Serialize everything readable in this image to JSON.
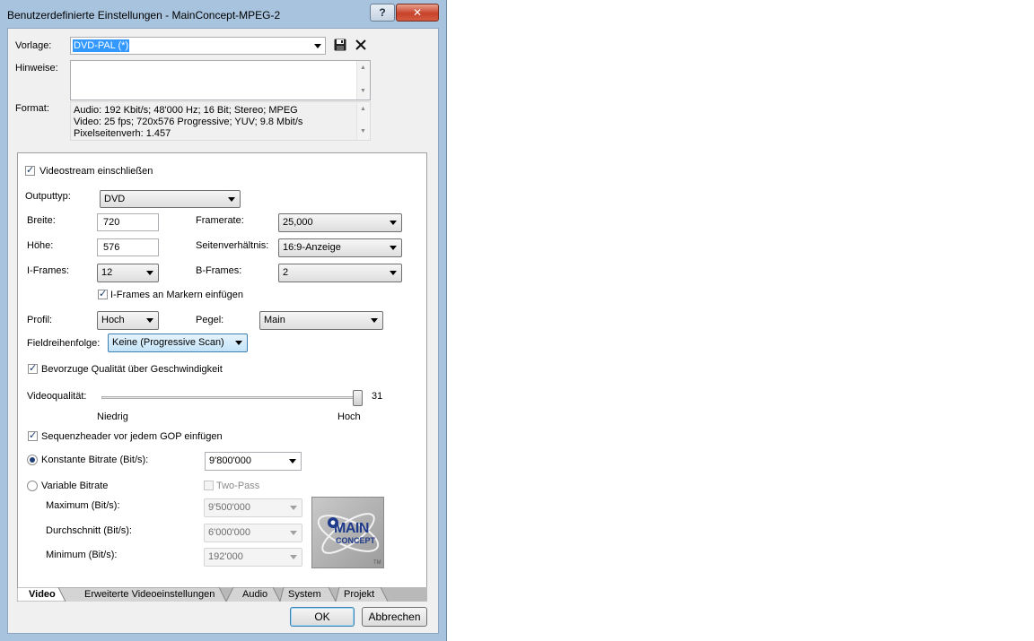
{
  "window": {
    "title": "Benutzerdefinierte Einstellungen - MainConcept-MPEG-2",
    "help_label": "?",
    "close_label": "✕"
  },
  "vorlage": {
    "label": "Vorlage:",
    "value": "DVD-PAL (*)"
  },
  "hinweise": {
    "label": "Hinweise:",
    "value": ""
  },
  "format": {
    "label": "Format:",
    "lines": [
      "Audio: 192 Kbit/s; 48'000 Hz; 16 Bit; Stereo; MPEG",
      "Video: 25 fps; 720x576 Progressive; YUV; 9.8 Mbit/s",
      "Pixelseitenverh: 1.457"
    ]
  },
  "video": {
    "include_stream": {
      "label": "Videostream einschließen",
      "checked": true
    },
    "output_type": {
      "label": "Outputtyp:",
      "value": "DVD"
    },
    "width": {
      "label": "Breite:",
      "value": "720"
    },
    "height": {
      "label": "Höhe:",
      "value": "576"
    },
    "framerate": {
      "label": "Framerate:",
      "value": "25,000"
    },
    "aspect": {
      "label": "Seitenverhältnis:",
      "value": "16:9-Anzeige"
    },
    "iframes": {
      "label": "I-Frames:",
      "value": "12"
    },
    "bframes": {
      "label": "B-Frames:",
      "value": "2"
    },
    "iframes_markers": {
      "label": "I-Frames an Markern einfügen",
      "checked": true
    },
    "profile": {
      "label": "Profil:",
      "value": "Hoch"
    },
    "level": {
      "label": "Pegel:",
      "value": "Main"
    },
    "field_order": {
      "label": "Fieldreihenfolge:",
      "value": "Keine (Progressive Scan)"
    },
    "prefer_quality": {
      "label": "Bevorzuge Qualität über Geschwindigkeit",
      "checked": true
    },
    "quality": {
      "label": "Videoqualität:",
      "value": "31",
      "min_label": "Niedrig",
      "max_label": "Hoch",
      "level": 1.0
    },
    "seq_header": {
      "label": "Sequenzheader vor jedem GOP einfügen",
      "checked": true
    },
    "constant_bitrate": {
      "label": "Konstante Bitrate (Bit/s):",
      "selected": true,
      "value": "9'800'000"
    },
    "variable_bitrate": {
      "label": "Variable Bitrate",
      "selected": false
    },
    "two_pass": {
      "label": "Two-Pass",
      "checked": false
    },
    "maximum": {
      "label": "Maximum (Bit/s):",
      "value": "9'500'000"
    },
    "average": {
      "label": "Durchschnitt (Bit/s):",
      "value": "6'000'000"
    },
    "minimum": {
      "label": "Minimum (Bit/s):",
      "value": "192'000"
    },
    "logo": {
      "line1": "MAIN",
      "line2": "CONCEPT",
      "tm": "TM"
    }
  },
  "tabs": [
    {
      "label": "Video",
      "active": true
    },
    {
      "label": "Erweiterte Videoeinstellungen",
      "active": false
    },
    {
      "label": "Audio",
      "active": false
    },
    {
      "label": "System",
      "active": false
    },
    {
      "label": "Projekt",
      "active": false
    }
  ],
  "buttons": {
    "ok": "OK",
    "cancel": "Abbrechen"
  },
  "icons": {
    "save": "save-icon",
    "delete": "delete-icon"
  }
}
